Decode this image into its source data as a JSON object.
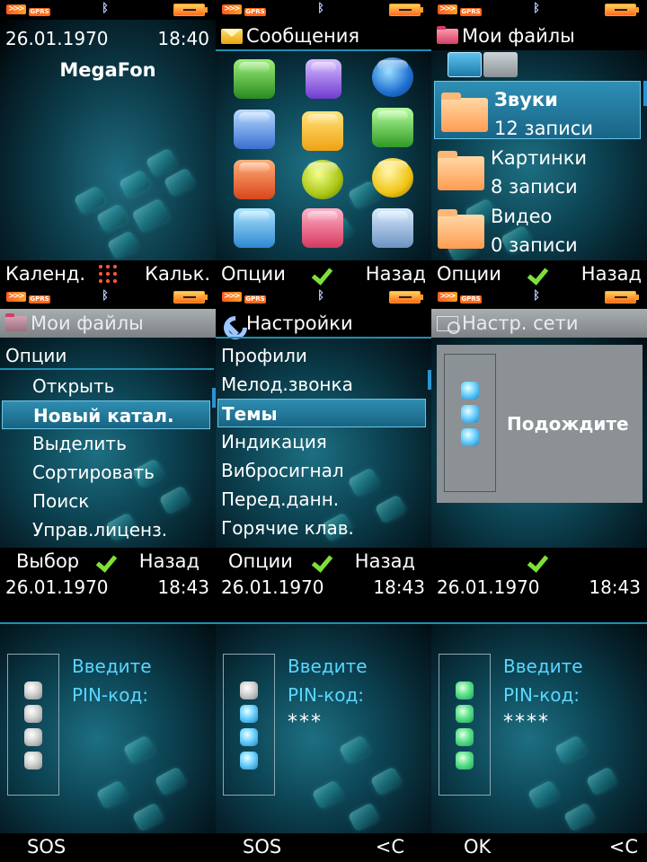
{
  "standby": {
    "date": "26.01.1970",
    "time": "18:40",
    "operator": "MegaFon",
    "soft_left": "Календ.",
    "soft_right": "Кальк."
  },
  "messages_menu": {
    "title": "Сообщения",
    "soft_left": "Опции",
    "soft_right": "Назад"
  },
  "files": {
    "title": "Мои файлы",
    "items": [
      {
        "name": "Звуки",
        "count": "12 записи"
      },
      {
        "name": "Картинки",
        "count": "8 записи"
      },
      {
        "name": "Видео",
        "count": "0 записи"
      }
    ],
    "soft_left": "Опции",
    "soft_right": "Назад"
  },
  "files_options": {
    "title": "Мои файлы",
    "subtitle": "Опции",
    "items": [
      "Открыть",
      "Новый катал.",
      "Выделить",
      "Сортировать",
      "Поиск",
      "Управ.лиценз."
    ],
    "soft_left": "Выбор",
    "soft_right": "Назад"
  },
  "settings": {
    "title": "Настройки",
    "items": [
      "Профили",
      "Мелод.звонка",
      "Темы",
      "Индикация",
      "Вибросигнал",
      "Перед.данн.",
      "Горячие клав."
    ],
    "soft_left": "Опции",
    "soft_right": "Назад"
  },
  "network": {
    "title": "Настр. сети",
    "message": "Подождите"
  },
  "pin_screens": [
    {
      "date": "26.01.1970",
      "time": "18:43",
      "prompt_line1": "Введите",
      "prompt_line2": "PIN-код:",
      "entry": "",
      "soft_left": "SOS",
      "soft_right": ""
    },
    {
      "date": "26.01.1970",
      "time": "18:43",
      "prompt_line1": "Введите",
      "prompt_line2": "PIN-код:",
      "entry": "***",
      "soft_left": "SOS",
      "soft_right": "<C"
    },
    {
      "date": "26.01.1970",
      "time": "18:43",
      "prompt_line1": "Введите",
      "prompt_line2": "PIN-код:",
      "entry": "****",
      "soft_left": "OK",
      "soft_right": "<C"
    }
  ],
  "status": {
    "gprs": "GPRS"
  },
  "colors": {
    "accent": "#1f8fb4",
    "highlight": "#2f8eb2",
    "pin_text": "#5ad6ff",
    "check": "#7ee03a"
  }
}
